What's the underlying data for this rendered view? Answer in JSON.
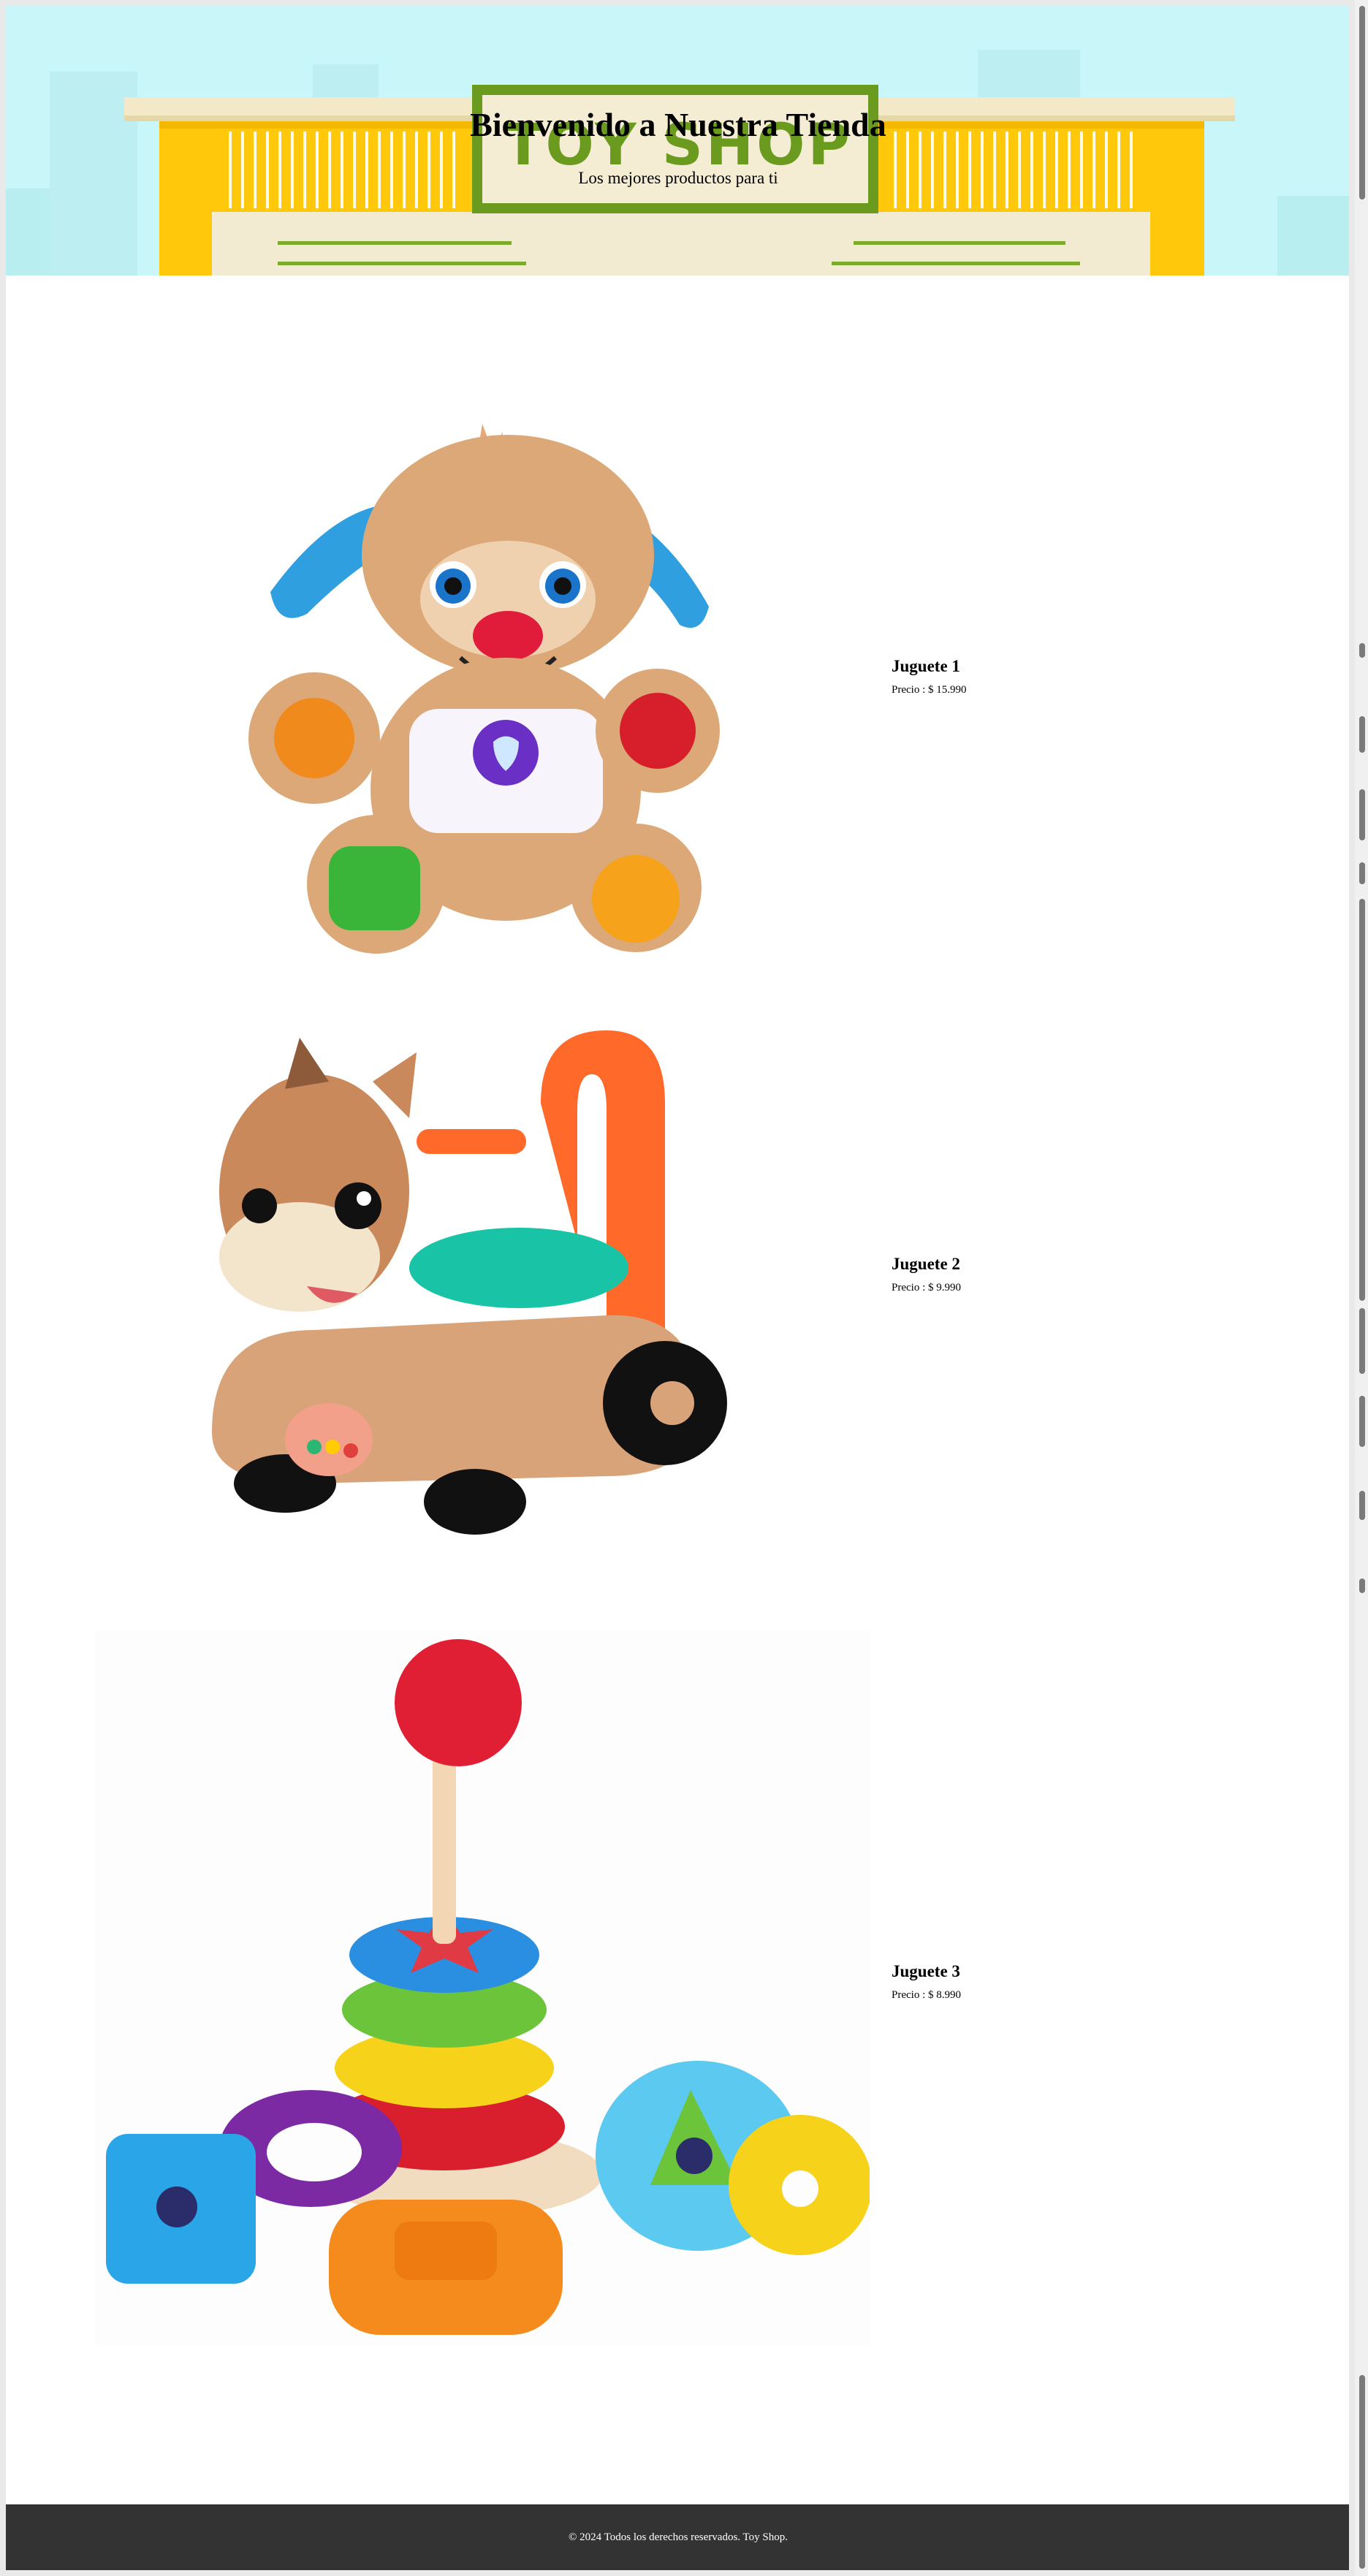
{
  "hero": {
    "title": "Bienvenido a Nuestra Tienda",
    "subtitle": "Los mejores productos para ti",
    "sign_text": "TOY SHOP"
  },
  "products": [
    {
      "name": "Juguete 1",
      "price": "Precio : $ 15.990",
      "image": "plush-puppy"
    },
    {
      "name": "Juguete 2",
      "price": "Precio : $ 9.990",
      "image": "horse-walker"
    },
    {
      "name": "Juguete 3",
      "price": "Precio : $ 8.990",
      "image": "stacking-rings"
    }
  ],
  "footer": {
    "text": "© 2024 Todos los derechos reservados. Toy Shop."
  },
  "colors": {
    "hero_sky": "#c9f6f8",
    "storefront_yellow": "#ffc80a",
    "sign_green": "#6a9b1f",
    "footer_bg": "#333333"
  }
}
